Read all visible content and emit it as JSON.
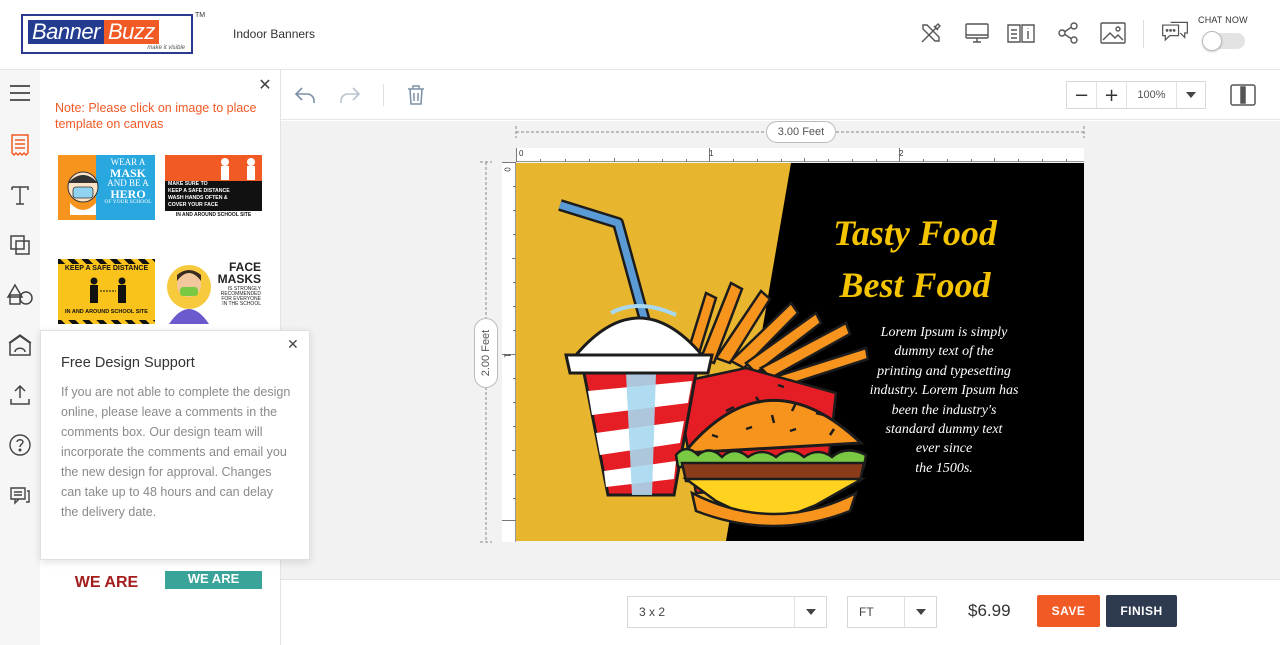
{
  "header": {
    "logo_text_a": "Banner",
    "logo_text_b": "Buzz",
    "logo_tagline": "make it visible",
    "logo_tm": "TM",
    "product_name": "Indoor Banners",
    "chat_label": "CHAT NOW",
    "icons": [
      "tools-icon",
      "preview-icon",
      "guide-icon",
      "share-icon",
      "image-icon",
      "chat-icon"
    ]
  },
  "rail": {
    "items": [
      "menu-icon",
      "templates-icon",
      "text-icon",
      "layers-icon",
      "shapes-icon",
      "background-icon",
      "upload-icon",
      "help-icon",
      "comments-icon"
    ]
  },
  "panel": {
    "note": "Note: Please click on image to place template on canvas",
    "thumbnails": [
      {
        "lines": [
          "WEAR A",
          "MASK",
          "AND BE A",
          "HERO",
          "OF YOUR SCHOOL"
        ]
      },
      {
        "lines": [
          "MAKE SURE TO",
          "KEEP A SAFE DISTANCE",
          "WASH HANDS OFTEN &",
          "COVER YOUR FACE",
          "IN AND AROUND SCHOOL SITE"
        ]
      },
      {
        "lines": [
          "KEEP A SAFE DISTANCE",
          "IN AND AROUND SCHOOL SITE"
        ]
      },
      {
        "lines": [
          "FACE",
          "MASKS",
          "IS STRONGLY",
          "RECOMMENDED",
          "FOR EVERYONE",
          "IN THE SCHOOL"
        ]
      },
      {
        "lines": [
          "WE ARE"
        ]
      },
      {
        "lines": [
          "WE ARE"
        ]
      }
    ]
  },
  "toolbar": {
    "zoom_value": "100%"
  },
  "canvas": {
    "width_label": "3.00 Feet",
    "height_label": "2.00 Feet",
    "hruler_numbers": [
      "0",
      "1",
      "2"
    ],
    "vruler_numbers": [
      "0",
      "1"
    ],
    "title_line1": "Tasty Food",
    "title_line2": "Best Food",
    "body_lines": [
      "Lorem Ipsum is simply",
      "dummy text of the",
      "printing and typesetting",
      "industry. Lorem Ipsum has",
      "been the industry's",
      "standard dummy text",
      "ever since",
      "the 1500s."
    ],
    "colors": {
      "left_bg": "#e8b52e",
      "right_bg": "#000000",
      "title": "#f5c400",
      "body": "#ffffff"
    }
  },
  "support": {
    "title": "Free Design Support",
    "text": "If you are not able to complete the design online, please leave a comments in the comments box. Our design team will incorporate the comments and email you the new design for approval. Changes can take up to 48 hours and can delay the delivery date."
  },
  "footer": {
    "size_value": "3 x 2",
    "unit_value": "FT",
    "price": "$6.99",
    "save_label": "SAVE",
    "finish_label": "FINISH"
  },
  "colors": {
    "accent": "#f15a24",
    "dark": "#2d3a4f",
    "brand_blue": "#243c8f"
  }
}
